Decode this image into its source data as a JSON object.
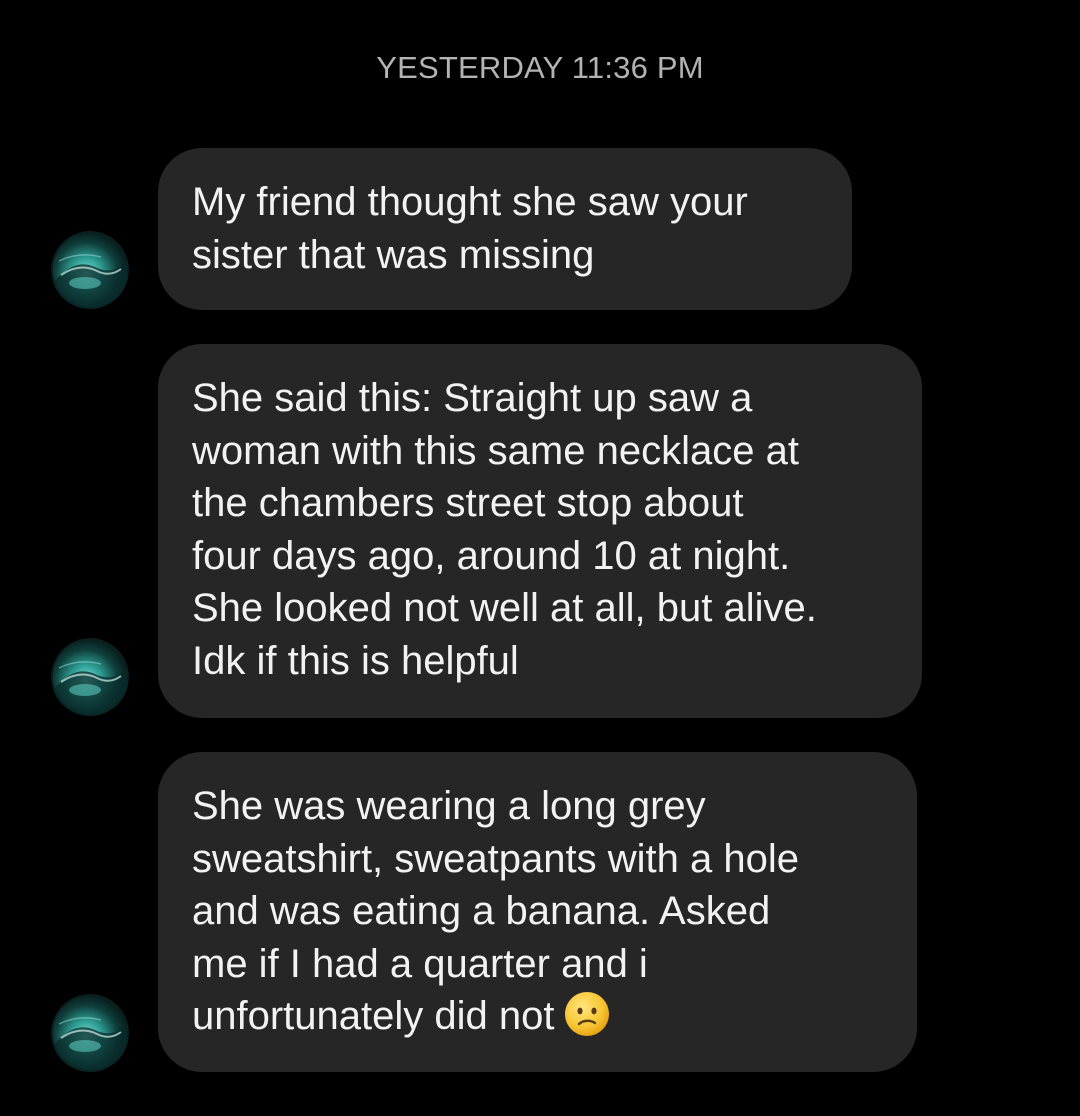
{
  "timestamp": "YESTERDAY 11:36 PM",
  "colors": {
    "background": "#000000",
    "bubble": "#262626",
    "timestamp_text": "#b3b3b3",
    "message_text": "#f2f2f2"
  },
  "messages": [
    {
      "lines": [
        "My friend thought she saw your",
        "sister that was missing"
      ],
      "avatar_icon": "ocean-wave-avatar-icon"
    },
    {
      "lines": [
        "She said this: Straight up saw a",
        "woman with this same necklace at",
        "the chambers street stop about",
        "four days ago, around 10 at night.",
        "She looked not well at all, but alive.",
        "Idk if this is helpful"
      ],
      "avatar_icon": "ocean-wave-avatar-icon"
    },
    {
      "lines": [
        "She was wearing a long grey",
        "sweatshirt, sweatpants with a hole",
        "and was eating a banana. Asked",
        "me if I had a quarter and i",
        "unfortunately did not"
      ],
      "trailing_emoji": "confused-face-emoji",
      "avatar_icon": "ocean-wave-avatar-icon"
    }
  ]
}
